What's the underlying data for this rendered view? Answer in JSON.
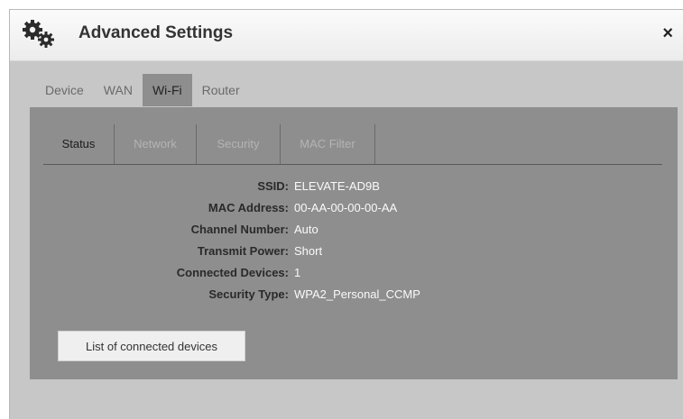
{
  "dialog": {
    "title": "Advanced Settings",
    "icon": "gear-icon",
    "close_label": "×"
  },
  "top_tabs": [
    {
      "label": "Device",
      "active": false
    },
    {
      "label": "WAN",
      "active": false
    },
    {
      "label": "Wi-Fi",
      "active": true
    },
    {
      "label": "Router",
      "active": false
    }
  ],
  "sub_tabs": [
    {
      "label": "Status",
      "active": true
    },
    {
      "label": "Network",
      "active": false
    },
    {
      "label": "Security",
      "active": false
    },
    {
      "label": "MAC Filter",
      "active": false
    }
  ],
  "status": {
    "ssid": {
      "label": "SSID:",
      "value": "ELEVATE-AD9B"
    },
    "mac": {
      "label": "MAC Address:",
      "value": "00-AA-00-00-00-AA"
    },
    "channel": {
      "label": "Channel Number:",
      "value": "Auto"
    },
    "power": {
      "label": "Transmit Power:",
      "value": "Short"
    },
    "devices": {
      "label": "Connected Devices:",
      "value": "1"
    },
    "security": {
      "label": "Security Type:",
      "value": "WPA2_Personal_CCMP"
    }
  },
  "buttons": {
    "connected_devices": "List of connected devices"
  },
  "colors": {
    "panel": "#8e8e8e",
    "dialog_bg": "#c7c7c7",
    "titlebar": "#f4f4f4"
  }
}
